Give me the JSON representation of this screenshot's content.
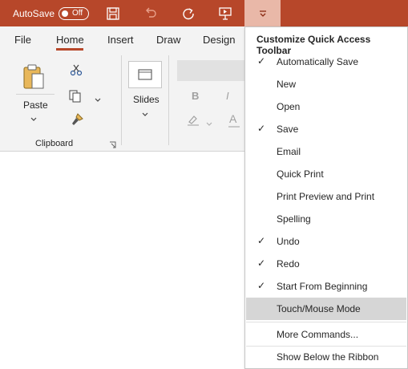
{
  "titlebar": {
    "autosave_label": "AutoSave",
    "autosave_state": "Off",
    "background": "#b7472a"
  },
  "ribbon": {
    "tabs": [
      "File",
      "Home",
      "Insert",
      "Draw",
      "Design"
    ],
    "active_tab": "Home",
    "groups": {
      "clipboard_label": "Clipboard",
      "paste_label": "Paste",
      "slides_label": "Slides"
    }
  },
  "menu": {
    "title": "Customize Quick Access Toolbar",
    "items": [
      {
        "label": "Automatically Save",
        "checked": true
      },
      {
        "label": "New",
        "checked": false
      },
      {
        "label": "Open",
        "checked": false
      },
      {
        "label": "Save",
        "checked": true
      },
      {
        "label": "Email",
        "checked": false
      },
      {
        "label": "Quick Print",
        "checked": false
      },
      {
        "label": "Print Preview and Print",
        "checked": false
      },
      {
        "label": "Spelling",
        "checked": false
      },
      {
        "label": "Undo",
        "checked": true
      },
      {
        "label": "Redo",
        "checked": true
      },
      {
        "label": "Start From Beginning",
        "checked": true
      },
      {
        "label": "Touch/Mouse Mode",
        "checked": false,
        "highlighted": true
      }
    ],
    "more_commands": "More Commands...",
    "show_below": "Show Below the Ribbon",
    "check_glyph": "✓"
  }
}
